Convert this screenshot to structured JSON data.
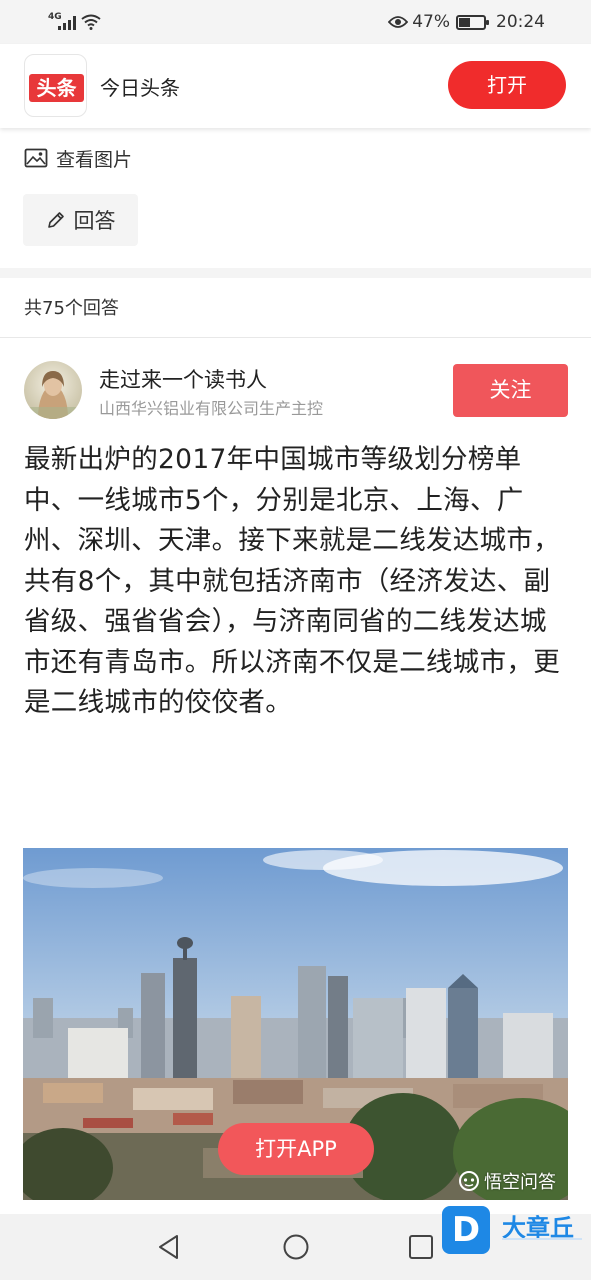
{
  "status_bar": {
    "network": "4G",
    "battery_percent": "47%",
    "battery_level": 0.47,
    "time": "20:24"
  },
  "app_header": {
    "logo_text": "头条",
    "app_name": "今日头条",
    "open_button": "打开"
  },
  "question": {
    "view_images_label": "查看图片",
    "answer_button_label": "回答"
  },
  "answers": {
    "count_label": "共75个回答"
  },
  "author": {
    "name": "走过来一个读书人",
    "description": "山西华兴铝业有限公司生产主控",
    "follow_button": "关注"
  },
  "answer_text": "最新出炉的2017年中国城市等级划分榜单中、一线城市5个，分别是北京、上海、广州、深圳、天津。接下来就是二线发达城市，共有8个，其中就包括济南市（经济发达、副省级、强省省会），与济南同省的二线发达城市还有青岛市。所以济南不仅是二线城市，更是二线城市的佼佼者。",
  "image_overlay": {
    "open_app_button": "打开APP",
    "watermark": "悟空问答"
  },
  "brand_badge": {
    "icon_letter": "D",
    "name": "大章丘"
  },
  "icons": {
    "image": "image-icon",
    "edit": "pencil-icon",
    "back": "back-triangle-icon",
    "home": "home-circle-icon",
    "recent": "recent-square-icon"
  }
}
